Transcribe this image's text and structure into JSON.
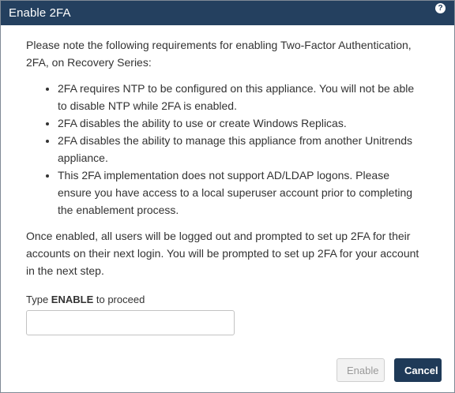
{
  "dialog": {
    "title": "Enable 2FA",
    "help_label": "?"
  },
  "content": {
    "intro": "Please note the following requirements for enabling Two-Factor Authentication, 2FA, on Recovery Series:",
    "requirements": [
      "2FA requires NTP to be configured on this appliance. You will not be able to disable NTP while 2FA is enabled.",
      "2FA disables the ability to use or create Windows Replicas.",
      "2FA disables the ability to manage this appliance from another Unitrends appliance.",
      "This 2FA implementation does not support AD/LDAP logons. Please ensure you have access to a local superuser account prior to completing the enablement process."
    ],
    "outro": "Once enabled, all users will be logged out and prompted to set up 2FA for their accounts on their next login. You will be prompted to set up 2FA for your account in the next step."
  },
  "confirm": {
    "label_prefix": "Type ",
    "label_keyword": "ENABLE",
    "label_suffix": " to proceed",
    "value": "",
    "placeholder": ""
  },
  "buttons": {
    "enable_label": "Enable",
    "cancel_label": "Cancel"
  },
  "colors": {
    "titlebar": "#24405f",
    "primary_button": "#1f3a58",
    "disabled_button_bg": "#f2f2f2",
    "disabled_button_text": "#9a9a9a"
  }
}
